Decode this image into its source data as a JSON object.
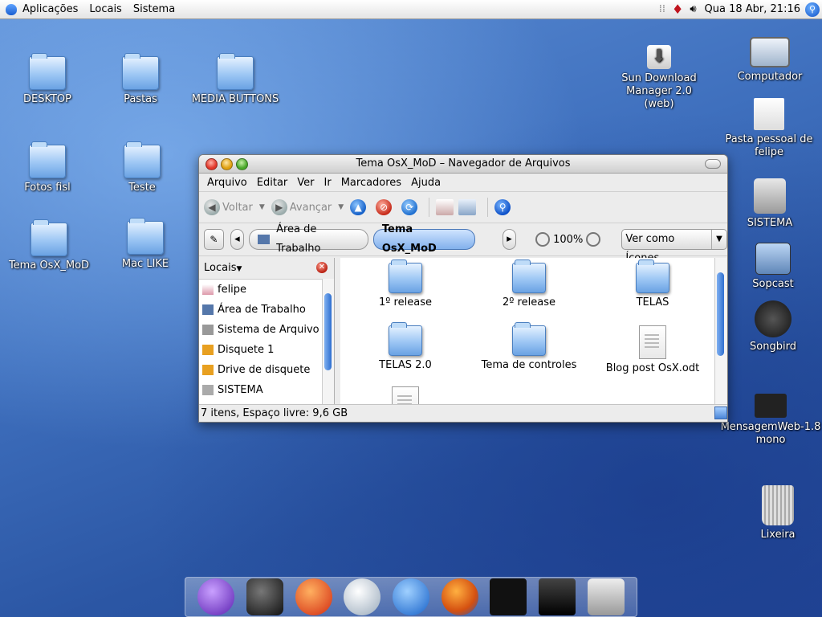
{
  "top_panel": {
    "menus": [
      "Aplicações",
      "Locais",
      "Sistema"
    ],
    "clock": "Qua 18 Abr, 21:16"
  },
  "desktop_left": [
    {
      "label": "DESKTOP"
    },
    {
      "label": "Pastas"
    },
    {
      "label": "MEDIA BUTTONS"
    },
    {
      "label": "Fotos fisl"
    },
    {
      "label": "Teste"
    },
    {
      "label": "Tema OsX_MoD"
    },
    {
      "label": "Mac LIKE"
    }
  ],
  "desktop_right": [
    {
      "label": "Sun Download Manager 2.0 (web)"
    },
    {
      "label": "Computador"
    },
    {
      "label": "Pasta pessoal de felipe"
    },
    {
      "label": "SISTEMA"
    },
    {
      "label": "Sopcast"
    },
    {
      "label": "Songbird"
    },
    {
      "label": "MensagemWeb-1.8 mono"
    },
    {
      "label": "Lixeira"
    }
  ],
  "window": {
    "title": "Tema OsX_MoD – Navegador de Arquivos",
    "menus": [
      "Arquivo",
      "Editar",
      "Ver",
      "Ir",
      "Marcadores",
      "Ajuda"
    ],
    "toolbar": {
      "back": "Voltar",
      "forward": "Avançar"
    },
    "location": {
      "crumb1": "Área de Trabalho",
      "crumb2": "Tema OsX_MoD",
      "zoom": "100%",
      "view_mode": "Ver como Ícones"
    },
    "sidebar": {
      "header": "Locais",
      "items": [
        "felipe",
        "Área de Trabalho",
        "Sistema de Arquivo",
        "Disquete 1",
        "Drive de disquete",
        "SISTEMA"
      ]
    },
    "files": [
      "1º release",
      "2º release",
      "TELAS",
      "TELAS 2.0",
      "Tema de controles",
      "Blog post OsX.odt"
    ],
    "status": "7 itens, Espaço livre: 9,6 GB"
  },
  "dock": [
    "chat",
    "camera",
    "burner",
    "itunes",
    "mail",
    "firefox",
    "real",
    "terminal",
    "disk"
  ]
}
